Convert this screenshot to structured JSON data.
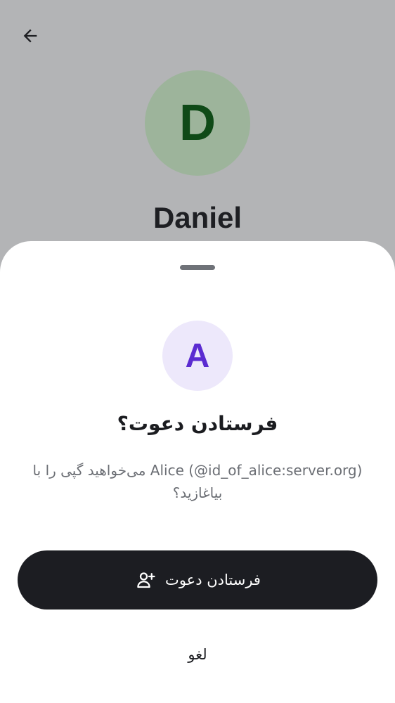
{
  "background": {
    "back_icon": "arrow-left-icon",
    "avatar_initial": "D",
    "name": "Daniel",
    "avatar_bg": "#9db49b",
    "avatar_fg": "#0f4a17"
  },
  "sheet": {
    "avatar_initial": "A",
    "avatar_bg": "#ede8fb",
    "avatar_fg": "#5b2bd1",
    "title": "فرستادن دعوت؟",
    "body": "Alice (@id_of_alice:server.org) می‌خواهید گپی را با بیاغازید؟",
    "primary_button": {
      "label": "فرستادن دعوت",
      "icon": "user-plus-icon"
    },
    "cancel_label": "لغو"
  }
}
